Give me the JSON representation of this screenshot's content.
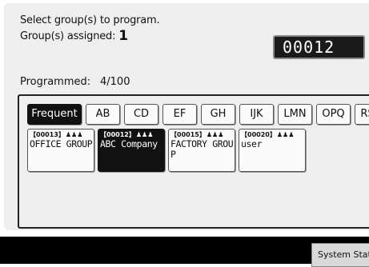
{
  "message": {
    "line1": "Select group(s) to program.",
    "assigned_label": "Group(s) assigned:",
    "assigned_count": "1"
  },
  "number_display": "00012",
  "programmed": {
    "label": "Programmed:",
    "value": "4/100"
  },
  "tabs": [
    {
      "label": "Frequent",
      "active": true
    },
    {
      "label": "AB"
    },
    {
      "label": "CD"
    },
    {
      "label": "EF"
    },
    {
      "label": "GH"
    },
    {
      "label": "IJK"
    },
    {
      "label": "LMN"
    },
    {
      "label": "OPQ"
    },
    {
      "label": "RST"
    }
  ],
  "entries": [
    {
      "number": "【00013】",
      "name": "OFFICE GROUP",
      "icon": "group-icon",
      "selected": false
    },
    {
      "number": "【00012】",
      "name": "ABC Company",
      "icon": "group-icon",
      "selected": true
    },
    {
      "number": "【00015】",
      "name": "FACTORY GROUP",
      "icon": "group-icon",
      "selected": false
    },
    {
      "number": "【00020】",
      "name": "user",
      "icon": "group-icon",
      "selected": false
    }
  ],
  "system_status": "System Status",
  "colors": {
    "panel": "#efefef",
    "selected": "#111111",
    "display_bg": "#1a1a1a"
  }
}
